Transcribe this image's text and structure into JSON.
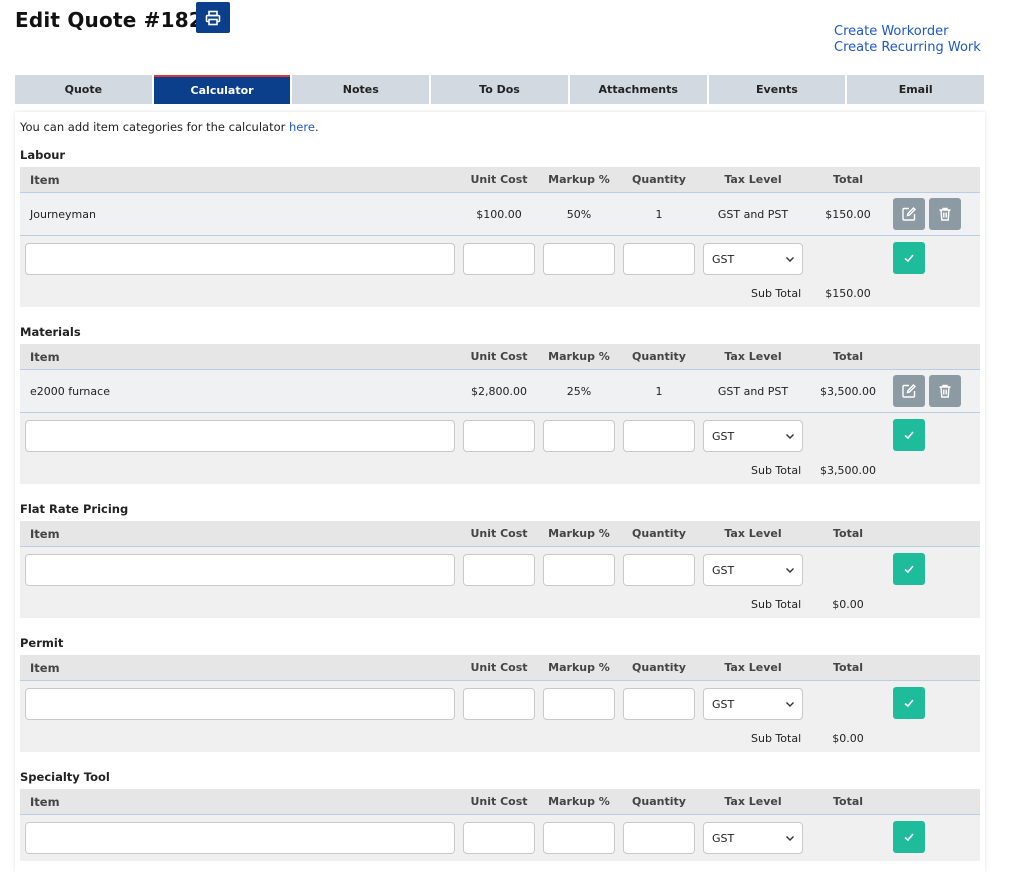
{
  "page": {
    "title": "Edit Quote #1828",
    "links": [
      "Create Workorder",
      "Create Recurring Work"
    ]
  },
  "tabs": [
    "Quote",
    "Calculator",
    "Notes",
    "To Dos",
    "Attachments",
    "Events",
    "Email"
  ],
  "active_tab": "Calculator",
  "intro": {
    "text": "You can add item categories for the calculator ",
    "link": "here",
    "end": "."
  },
  "columns": {
    "item": "Item",
    "unit_cost": "Unit Cost",
    "markup": "Markup %",
    "quantity": "Quantity",
    "tax_level": "Tax Level",
    "total": "Total"
  },
  "default_tax": "GST",
  "subtotal_label": "Sub Total",
  "sections": [
    {
      "title": "Labour",
      "rows": [
        {
          "item": "Journeyman",
          "unit_cost": "$100.00",
          "markup": "50%",
          "quantity": "1",
          "tax_level": "GST and PST",
          "total": "$150.00"
        }
      ],
      "subtotal": "$150.00"
    },
    {
      "title": "Materials",
      "rows": [
        {
          "item": "e2000 furnace",
          "unit_cost": "$2,800.00",
          "markup": "25%",
          "quantity": "1",
          "tax_level": "GST and PST",
          "total": "$3,500.00"
        }
      ],
      "subtotal": "$3,500.00"
    },
    {
      "title": "Flat Rate Pricing",
      "rows": [],
      "subtotal": "$0.00"
    },
    {
      "title": "Permit",
      "rows": [],
      "subtotal": "$0.00"
    },
    {
      "title": "Specialty Tool",
      "rows": [],
      "subtotal": ""
    }
  ],
  "colors": {
    "primary": "#0b3f8c",
    "accent_line": "#d43a3a",
    "link": "#1d57c9",
    "confirm": "#1fbc9c",
    "icon_button": "#8c9aa3"
  }
}
